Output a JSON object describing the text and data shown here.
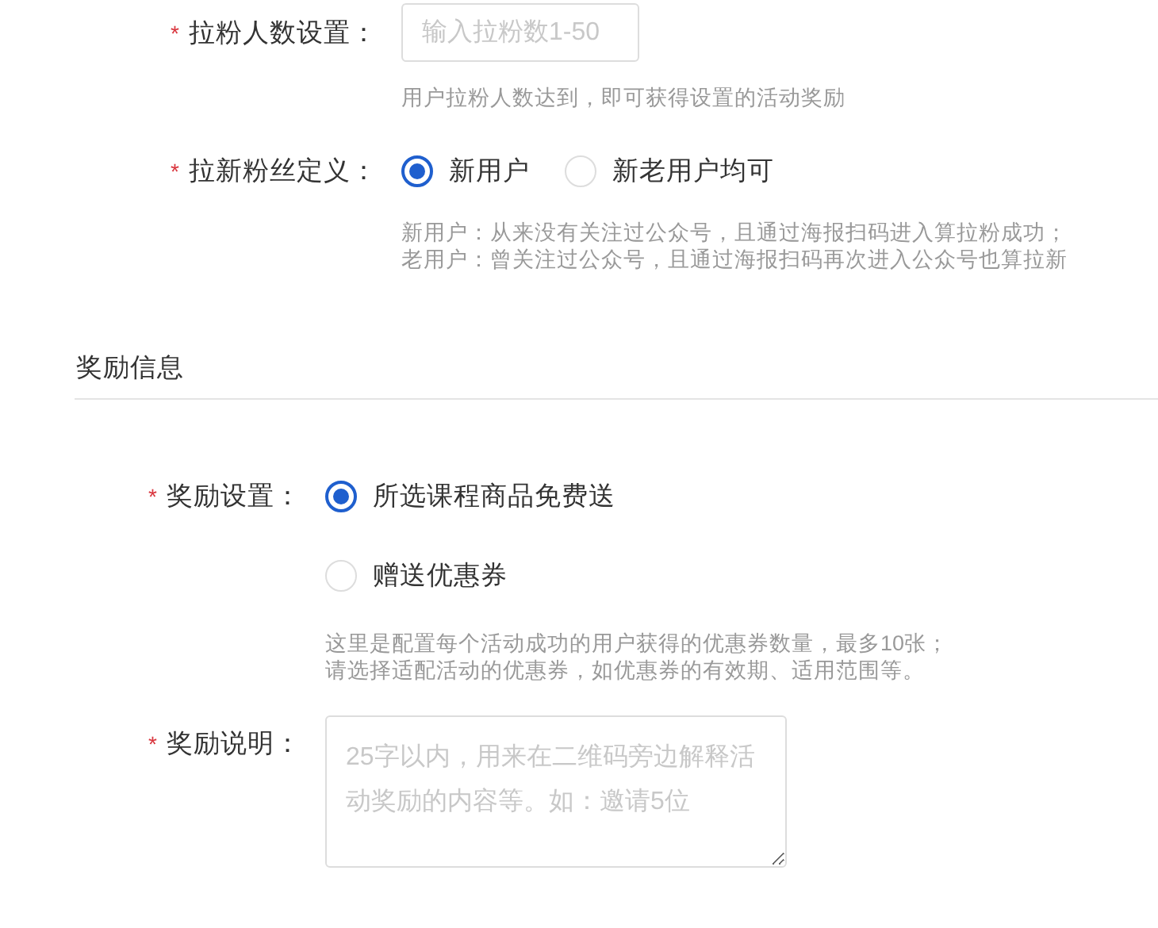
{
  "rules": [
    {
      "kind": "input",
      "required_mark": "*",
      "label": "拉粉人数设置：",
      "placeholder": "输入拉粉数1-50",
      "hint": [
        "用户拉粉人数达到，即可获得设置的活动奖励"
      ]
    },
    {
      "kind": "radio",
      "required_mark": "*",
      "label": "拉新粉丝定义：",
      "options": [
        {
          "label": "新用户",
          "selected": true
        },
        {
          "label": "新老用户均可",
          "selected": false
        }
      ],
      "hint": [
        "新用户：从来没有关注过公众号，且通过海报扫码进入算拉粉成功；",
        "老用户：曾关注过公众号，且通过海报扫码再次进入公众号也算拉新"
      ]
    }
  ],
  "section": {
    "title": "奖励信息"
  },
  "reward": [
    {
      "kind": "radio-stack",
      "required_mark": "*",
      "label": "奖励设置：",
      "options": [
        {
          "label": "所选课程商品免费送",
          "selected": true
        },
        {
          "label": "赠送优惠券",
          "selected": false
        }
      ],
      "hint": [
        "这里是配置每个活动成功的用户获得的优惠券数量，最多10张；",
        "请选择适配活动的优惠券，如优惠券的有效期、适用范围等。"
      ]
    },
    {
      "kind": "textarea",
      "required_mark": "*",
      "label": "奖励说明：",
      "placeholder": "25字以内，用来在二维码旁边解释活动奖励的内容等。如：邀请5位"
    }
  ]
}
